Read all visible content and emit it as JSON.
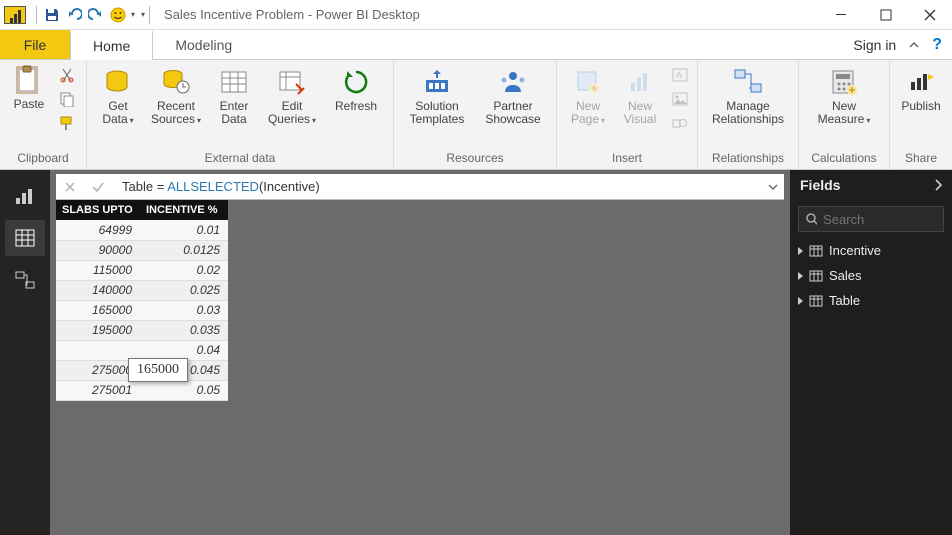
{
  "titlebar": {
    "title": "Sales Incentive Problem - Power BI Desktop"
  },
  "tabs": {
    "file": "File",
    "home": "Home",
    "modeling": "Modeling",
    "signin": "Sign in"
  },
  "ribbon": {
    "clipboard": {
      "label": "Clipboard",
      "paste": "Paste"
    },
    "external": {
      "label": "External data",
      "get_data": "Get\nData",
      "recent_sources": "Recent\nSources",
      "enter_data": "Enter\nData",
      "edit_queries": "Edit\nQueries",
      "refresh": "Refresh"
    },
    "resources": {
      "label": "Resources",
      "solution_templates": "Solution\nTemplates",
      "partner_showcase": "Partner\nShowcase"
    },
    "insert": {
      "label": "Insert",
      "new_page": "New\nPage",
      "new_visual": "New\nVisual"
    },
    "relationships": {
      "label": "Relationships",
      "manage": "Manage\nRelationships"
    },
    "calculations": {
      "label": "Calculations",
      "new_measure": "New\nMeasure"
    },
    "share": {
      "label": "Share",
      "publish": "Publish"
    }
  },
  "formula": {
    "prefix": "Table = ",
    "func": "ALLSELECTED",
    "args": "(Incentive)"
  },
  "table": {
    "headers": [
      "SLABS UPTO",
      "INCENTIVE %"
    ],
    "rows": [
      [
        "64999",
        "0.01"
      ],
      [
        "90000",
        "0.0125"
      ],
      [
        "115000",
        "0.02"
      ],
      [
        "140000",
        "0.025"
      ],
      [
        "165000",
        "0.03"
      ],
      [
        "195000",
        "0.035"
      ],
      [
        "",
        "0.04"
      ],
      [
        "275000",
        "0.045"
      ],
      [
        "275001",
        "0.05"
      ]
    ],
    "tooltip_value": "165000"
  },
  "fields": {
    "title": "Fields",
    "search_placeholder": "Search",
    "items": [
      "Incentive",
      "Sales",
      "Table"
    ]
  }
}
